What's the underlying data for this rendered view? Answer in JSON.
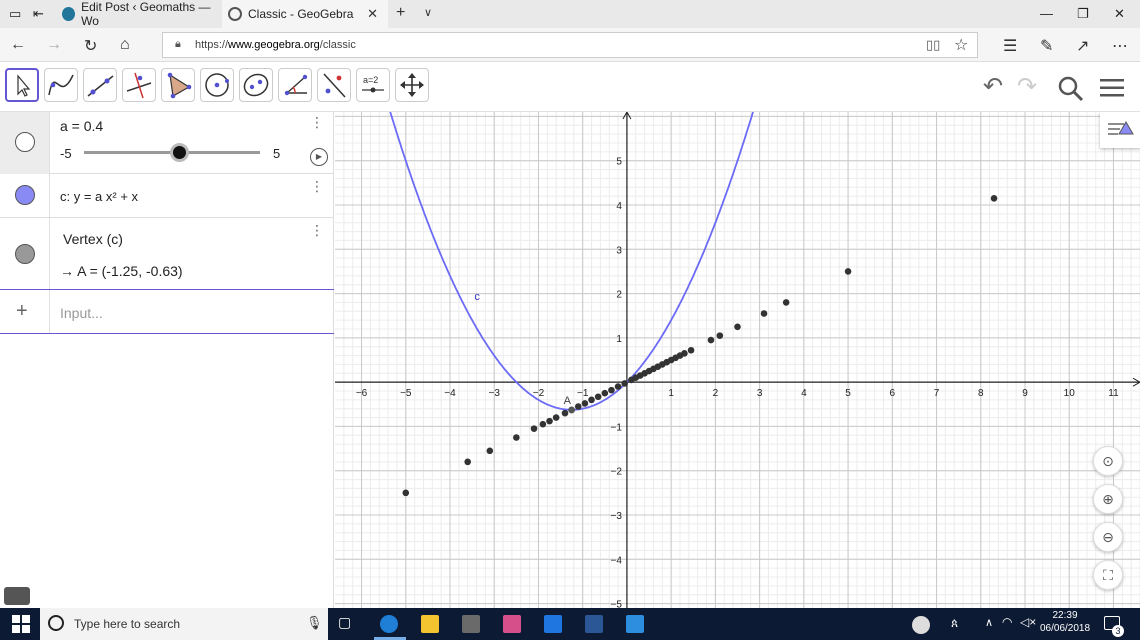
{
  "browser": {
    "tabs": [
      {
        "label": "Edit Post ‹ Geomaths — Wo",
        "active": false
      },
      {
        "label": "Classic - GeoGebra",
        "active": true
      }
    ],
    "url_prefix": "https://",
    "url_domain": "www.geogebra.org",
    "url_path": "/classic"
  },
  "algebra": {
    "slider": {
      "label": "a = 0.4",
      "min": "-5",
      "max": "5",
      "value": 0.4
    },
    "function": {
      "label": "c: y = a x² + x",
      "color": "#6b6bf7"
    },
    "vertex": {
      "label": "Vertex (c)",
      "result": "→  A = (-1.25, -0.63)"
    },
    "input_placeholder": "Input..."
  },
  "graph": {
    "curve_label": "c",
    "point_label": "A",
    "x_ticks": [
      "−6",
      "−5",
      "−4",
      "−3",
      "−2",
      "−1",
      "1",
      "2",
      "3",
      "4",
      "5",
      "6",
      "7",
      "8",
      "9",
      "10",
      "11"
    ],
    "y_ticks": [
      "5",
      "4",
      "3",
      "2",
      "1",
      "−1",
      "−2",
      "−3",
      "−4",
      "−5"
    ],
    "x_range": [
      -6.6,
      11.6
    ],
    "y_range": [
      -5.1,
      6.1
    ],
    "a": 0.4,
    "curve_color": "#6b6bf7",
    "points": [
      [
        -5,
        -2.5
      ],
      [
        -3.6,
        -1.8
      ],
      [
        -3.1,
        -1.55
      ],
      [
        -2.5,
        -1.25
      ],
      [
        -2.1,
        -1.05
      ],
      [
        -1.9,
        -0.95
      ],
      [
        -1.75,
        -0.88
      ],
      [
        -1.6,
        -0.8
      ],
      [
        -1.4,
        -0.7
      ],
      [
        -1.25,
        -0.63
      ],
      [
        -1.1,
        -0.55
      ],
      [
        -0.95,
        -0.48
      ],
      [
        -0.8,
        -0.4
      ],
      [
        -0.65,
        -0.33
      ],
      [
        -0.5,
        -0.25
      ],
      [
        -0.35,
        -0.18
      ],
      [
        -0.2,
        -0.1
      ],
      [
        -0.05,
        -0.03
      ],
      [
        0.1,
        0.05
      ],
      [
        0.2,
        0.1
      ],
      [
        0.3,
        0.15
      ],
      [
        0.4,
        0.2
      ],
      [
        0.5,
        0.25
      ],
      [
        0.6,
        0.3
      ],
      [
        0.7,
        0.35
      ],
      [
        0.8,
        0.4
      ],
      [
        0.9,
        0.45
      ],
      [
        1.0,
        0.5
      ],
      [
        1.1,
        0.55
      ],
      [
        1.2,
        0.6
      ],
      [
        1.3,
        0.65
      ],
      [
        1.45,
        0.72
      ],
      [
        1.9,
        0.95
      ],
      [
        2.1,
        1.05
      ],
      [
        2.5,
        1.25
      ],
      [
        3.1,
        1.55
      ],
      [
        3.6,
        1.8
      ],
      [
        5.0,
        2.5
      ],
      [
        8.3,
        4.15
      ]
    ]
  },
  "taskbar": {
    "search_placeholder": "Type here to search",
    "time": "22:39",
    "date": "06/06/2018",
    "notifications": "3"
  }
}
